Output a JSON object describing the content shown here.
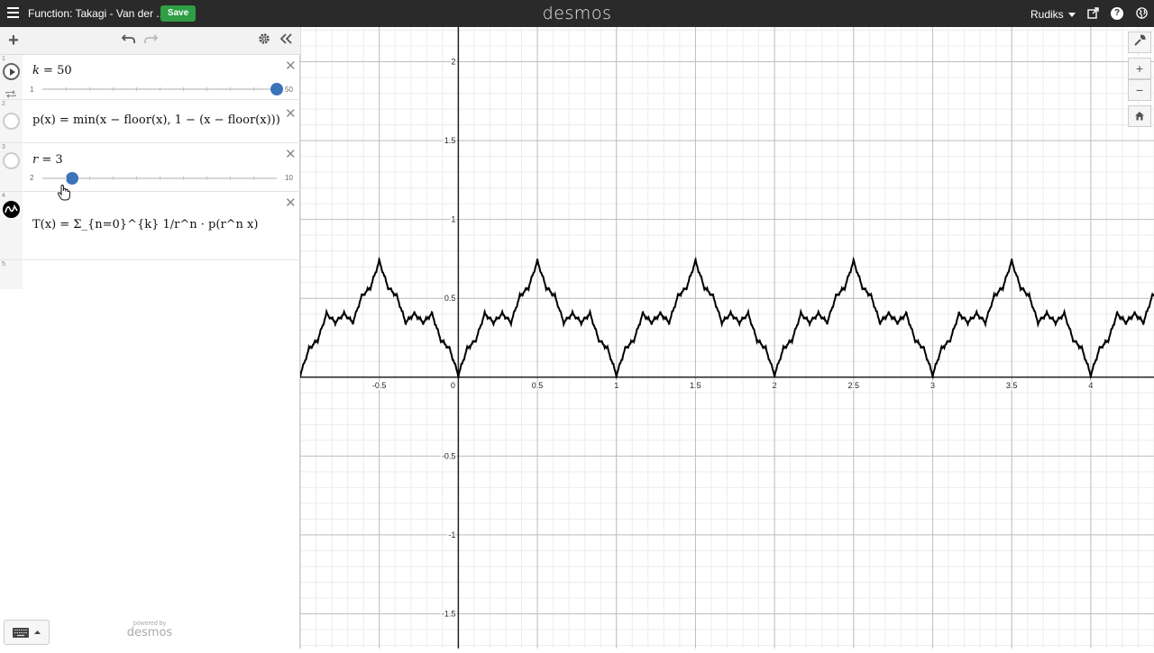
{
  "header": {
    "doc_title": "Function: Takagi - Van der ...",
    "save_label": "Save",
    "brand": "desmos",
    "user": "Rudiks"
  },
  "expressions": [
    {
      "index": "1",
      "lhs": "k",
      "value": "50",
      "slider_min": "1",
      "slider_max": "50",
      "slider_fraction": 1.0
    },
    {
      "index": "2",
      "formula": "p(x) = min(x − floor(x), 1 − (x − floor(x)))"
    },
    {
      "index": "3",
      "lhs": "r",
      "value": "3",
      "slider_min": "2",
      "slider_max": "10",
      "slider_fraction": 0.125
    },
    {
      "index": "4",
      "formula": "T(x) = Σ_{n=0}^{k} 1/r^n · p(r^n x)"
    },
    {
      "index": "5"
    }
  ],
  "footer": {
    "powered_by": "powered by",
    "brand": "desmos"
  },
  "graph": {
    "x_range": [
      -1.0,
      4.4
    ],
    "y_range": [
      -1.72,
      2.22
    ],
    "x_tick_labels": [
      "-0.5",
      "0",
      "0.5",
      "1",
      "1.5",
      "2",
      "2.5",
      "3",
      "3.5",
      "4"
    ],
    "y_tick_labels": [
      "2",
      "1.5",
      "1",
      "0.5",
      "-0.5",
      "-1",
      "-1.5"
    ],
    "curve_color": "#000000",
    "grid_major_color": "#bfbfbf",
    "grid_minor_color": "#ececec"
  },
  "colors": {
    "accent": "#3c73b9",
    "save": "#2f9e44",
    "topbar": "#2a2a2a"
  }
}
